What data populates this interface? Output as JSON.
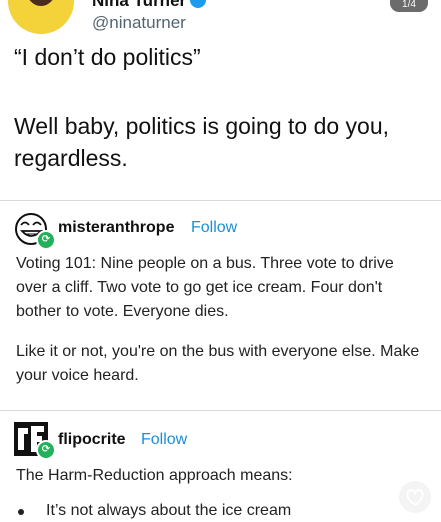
{
  "tweet": {
    "display_name": "Nina Turner",
    "handle": "@ninaturner",
    "line1": "“I don’t do politics”",
    "line2": "Well baby, politics is going to do you, regardless."
  },
  "page_badge": "1/4",
  "posts": [
    {
      "blog": "misteranthrope",
      "follow": "Follow",
      "paragraphs": [
        "Voting 101: Nine people on a bus. Three vote to drive over a cliff. Two vote to go get ice cream. Four don't bother to vote. Everyone dies.",
        "Like it or not, you're on the bus with everyone else. Make your voice heard."
      ]
    },
    {
      "blog": "flipocrite",
      "follow": "Follow",
      "paragraphs": [
        "The Harm-Reduction approach means:"
      ],
      "bullets": [
        "It’s not always about the ice cream"
      ]
    }
  ],
  "colors": {
    "follow": "#1a8fd8",
    "reblog": "#21b15a",
    "avatar_bg": "#f3d23a"
  }
}
